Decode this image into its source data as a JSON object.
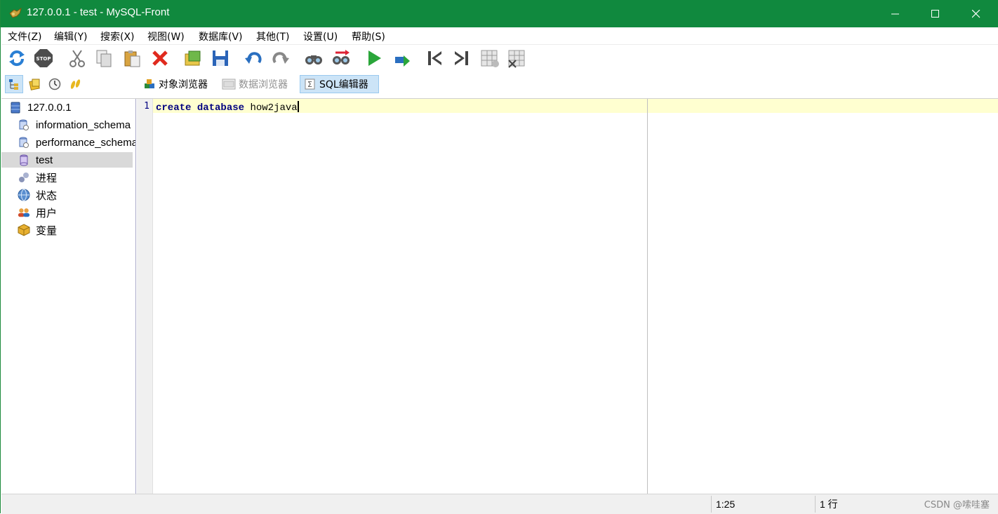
{
  "window": {
    "title": "127.0.0.1 - test - MySQL-Front",
    "titlebar_color": "#10893e"
  },
  "menu": [
    {
      "label": "文件(Z)"
    },
    {
      "label": "编辑(Y)"
    },
    {
      "label": "搜索(X)"
    },
    {
      "label": "视图(W)"
    },
    {
      "label": "数据库(V)"
    },
    {
      "label": "其他(T)"
    },
    {
      "label": "设置(U)"
    },
    {
      "label": "帮助(S)"
    }
  ],
  "toolbar_icons": [
    "refresh-icon",
    "stop-icon",
    "cut-icon",
    "copy-icon",
    "paste-icon",
    "delete-icon",
    "open-icon",
    "save-icon",
    "undo-icon",
    "redo-icon",
    "find-icon",
    "replace-icon",
    "run-icon",
    "run-selection-icon",
    "first-icon",
    "last-icon",
    "insert-record-icon",
    "delete-record-icon"
  ],
  "tabs": {
    "object_browser": "对象浏览器",
    "data_browser": "数据浏览器",
    "sql_editor": "SQL编辑器"
  },
  "tree": {
    "server": "127.0.0.1",
    "items": [
      {
        "label": "information_schema"
      },
      {
        "label": "performance_schema"
      },
      {
        "label": "test"
      },
      {
        "label": "进程"
      },
      {
        "label": "状态"
      },
      {
        "label": "用户"
      },
      {
        "label": "变量"
      }
    ]
  },
  "editor": {
    "line_number": "1",
    "keyword1": "create",
    "keyword2": "database",
    "identifier": "how2java"
  },
  "status": {
    "position": "1:25",
    "lines": "1 行",
    "watermark": "CSDN @嗦哇塞"
  }
}
